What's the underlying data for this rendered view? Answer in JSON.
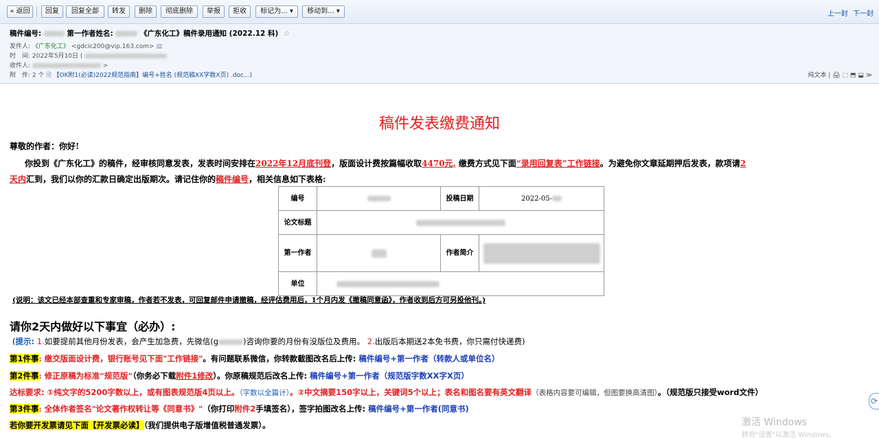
{
  "toolbar": {
    "buttons": [
      "« 返回",
      "回复",
      "回复全部",
      "转发",
      "删除",
      "彻底删除",
      "举报",
      "拒收",
      "标记为... ▾",
      "移动到... ▾"
    ],
    "nav_prev": "上一封",
    "nav_next": "下一封"
  },
  "header": {
    "subject_prefix": "稿件编号:",
    "subject_mid": "第一作者姓名:",
    "subject_tail": "《广东化工》稿件录用通知 (2022.12 科)",
    "from_key": "发件人:",
    "from_name": "《广东化工》",
    "from_email": "<gdcic200@vip.163.com>",
    "time_key": "时　间:",
    "time_value": "2022年5月10日 (",
    "to_key": "收件人:",
    "attach_key": "附　件:",
    "attach_count": "2 个",
    "attach_name": "【OK附1(必读)2022规范指南】编号+姓名 (规范稿XX字数X页) .doc...)",
    "view_options": "纯文本 | 🖨 ⬚ ⬒ ⬓ ≫"
  },
  "body": {
    "title": "稿件发表缴费通知",
    "greeting": "尊敬的作者：你好!",
    "p1_a": "你投到《广东化工》的稿件，经审核同意发表，发表时间安排在",
    "p1_date": "2022年12月底刊登",
    "p1_b": "，版面设计费按篇幅收取",
    "p1_fee": "4470元,",
    "p1_c": " 缴费方式见下面",
    "p1_link": "“录用回复表”工作链接",
    "p1_d": "。为避免你文章延期押后发表，款项请",
    "p1_e": "2",
    "p2_a": "天内",
    "p2_b": "汇到，我们以你的汇款日确定出版期次。请记住你的",
    "p2_c": "稿件编号",
    "p2_d": "，相关信息如下表格:",
    "table": {
      "r1_l1": "编号",
      "r1_l2": "投稿日期",
      "r1_v2": "2022-05-",
      "r2_l1": "论文标题",
      "r3_l1": "第一作者",
      "r3_l2": "作者简介",
      "r4_l1": "单位"
    },
    "note": "(说明：该文已经本部查重和专家审稿，作者若不发表，可回复邮件申请撤稿，经评估费用后，1个月内发《撤稿同意函》，作者收到后方可另投他刊。)",
    "todo_title": "请你2天内做好以下事宜（必办）:",
    "tip_a": "(",
    "tip_key": "提示:",
    "tip_1": " 1.",
    "tip_b": "如要提前其他月份发表，会产生加急费，先微信(g",
    "tip_c": ")咨询你要的月份有没版位及费用。",
    "tip_2": " 2.",
    "tip_d": "出版后本期送2本免书费，你只需付快递费)",
    "t1_tag": "第1件事",
    "t1_a": ": 缴交版面设计费，银行账号",
    "t1_b": "见下面\"工作链接\"",
    "t1_c": "。有问题联系微信，你转款截图改名后上传:",
    "t1_d": " 稿件编号+第一作者（转款人或单位名）",
    "t2_tag": "第2件事",
    "t2_a": ": 修正原稿为标准“规范版”",
    "t2_b": "（你务必下载",
    "t2_c": "附件1修改",
    "t2_d": "）。你原稿规范后改名上传:",
    "t2_e": " 稿件编号+第一作者（规范版字数XX字X页）",
    "t3_tag": "达标要求",
    "t3_a": ": ①纯文字的5200字数以上，或有图表规范版4页以上。",
    "t3_b": "（字数以全篇计）",
    "t3_c": "。②中文摘要150字以上，关键词5个以上；表名和图名要有英文翻译",
    "t3_d": "（表格内容要可编辑，但图要换高清图）",
    "t3_e": "。（规范版只接受word文件）",
    "t4_tag": "第3件事",
    "t4_a": ": 全体作者签名\"论文著作权转让等《同意书》\"",
    "t4_b": "（你打印",
    "t4_c": "附件2",
    "t4_d": "手填签名），签字拍图改名上传:",
    "t4_e": " 稿件编号+第一作者(同意书)",
    "t5_tag": "若你要开发票请见下面【开发票必读】",
    "t5_a": "（我们提供电子版增值税普通发票）。"
  },
  "watermark": {
    "line1": "激活 Windows",
    "line2": "转到\"设置\"以激活 Windows。"
  }
}
